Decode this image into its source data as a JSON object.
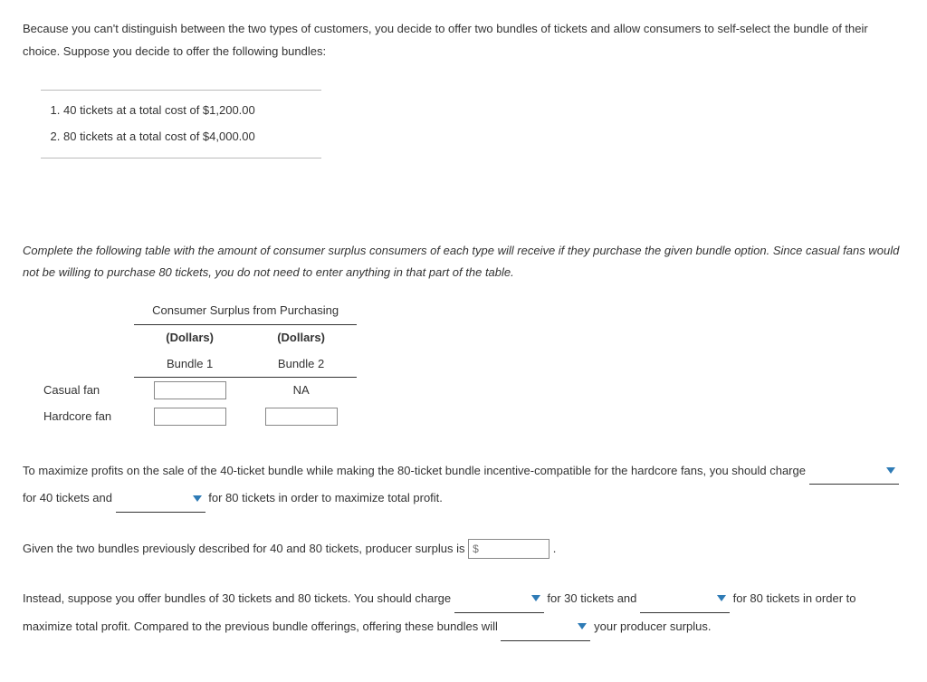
{
  "intro": "Because you can't distinguish between the two types of customers, you decide to offer two bundles of tickets and allow consumers to self-select the bundle of their choice. Suppose you decide to offer the following bundles:",
  "bundles": {
    "item1": "40 tickets at a total cost of $1,200.00",
    "item2": "80 tickets at a total cost of $4,000.00"
  },
  "instruction": "Complete the following table with the amount of consumer surplus consumers of each type will receive if they purchase the given bundle option. Since casual fans would not be willing to purchase 80 tickets, you do not need to enter anything in that part of the table.",
  "table": {
    "title": "Consumer Surplus from Purchasing",
    "unit1": "(Dollars)",
    "unit2": "(Dollars)",
    "col1": "Bundle 1",
    "col2": "Bundle 2",
    "row1": "Casual fan",
    "row2": "Hardcore fan",
    "na": "NA"
  },
  "p1": {
    "a": "To maximize profits on the sale of the 40-ticket bundle while making the 80-ticket bundle incentive-compatible for the hardcore fans, you should charge ",
    "b": " for 40 tickets and ",
    "c": " for 80 tickets in order to maximize total profit."
  },
  "p2": {
    "a": "Given the two bundles previously described for 40 and 80 tickets, producer surplus is ",
    "b": " .",
    "placeholder": "$"
  },
  "p3": {
    "a": "Instead, suppose you offer bundles of 30 tickets and 80 tickets. You should charge ",
    "b": " for 30 tickets and ",
    "c": " for 80 tickets in order to maximize total profit. Compared to the previous bundle offerings, offering these bundles will ",
    "d": " your producer surplus."
  }
}
